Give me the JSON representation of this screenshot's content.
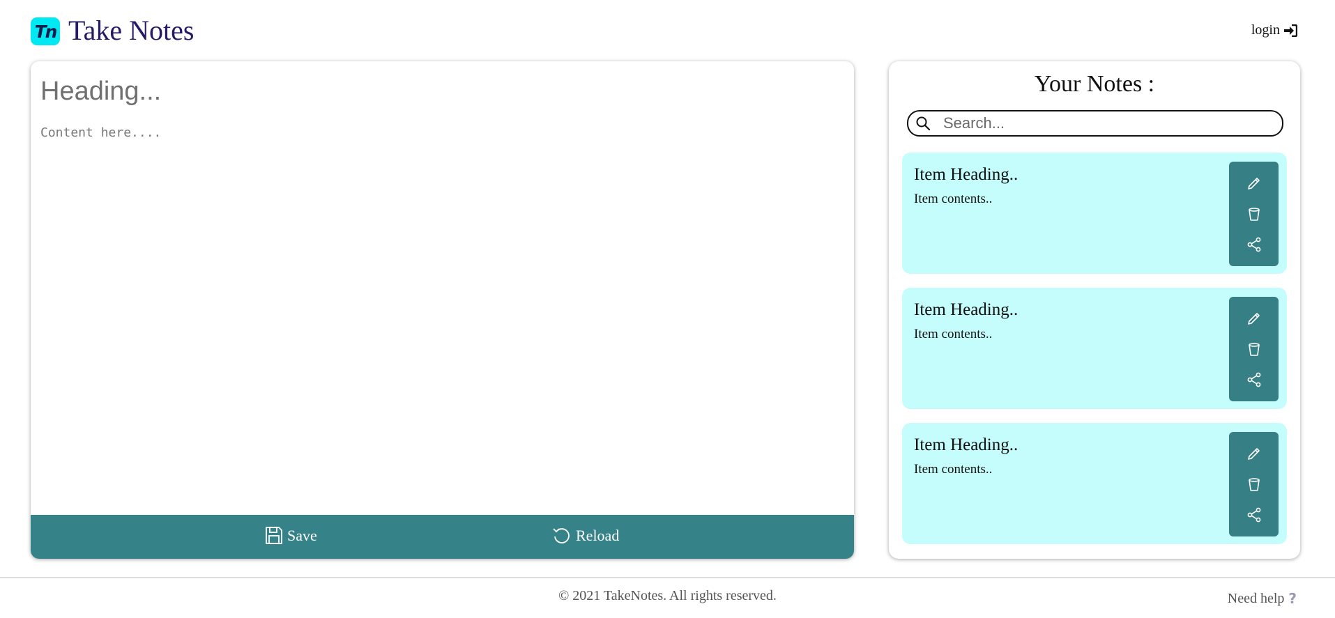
{
  "header": {
    "logo_text": "Tn",
    "app_title": "Take Notes",
    "login_label": "login",
    "logo_color": "#00e8f2"
  },
  "editor": {
    "heading_placeholder": "Heading...",
    "content_placeholder": "Content here....",
    "save_label": "Save",
    "reload_label": "Reload",
    "footer_color": "#358289"
  },
  "notes_panel": {
    "title": "Your Notes :",
    "search_placeholder": "Search...",
    "item_color": "#c5fdfd",
    "action_color": "#367f84",
    "items": [
      {
        "heading": "Item Heading..",
        "content": "Item contents.."
      },
      {
        "heading": "Item Heading..",
        "content": "Item contents.."
      },
      {
        "heading": "Item Heading..",
        "content": "Item contents.."
      }
    ]
  },
  "footer": {
    "copyright": "© 2021 TakeNotes. All rights reserved.",
    "help_label": "Need help",
    "help_icon": "?"
  },
  "icons": {
    "login": "sign-in-icon",
    "save": "floppy-disk-icon",
    "reload": "reload-icon",
    "search": "search-icon",
    "edit": "pencil-icon",
    "delete": "trash-icon",
    "share": "share-icon"
  }
}
